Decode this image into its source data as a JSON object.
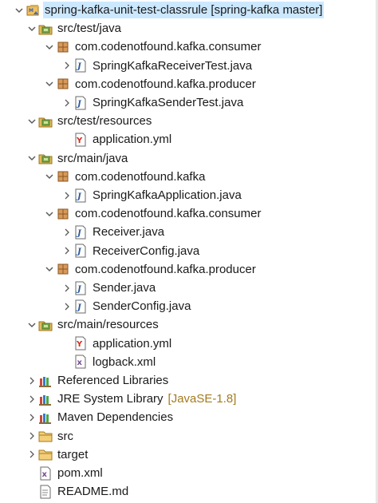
{
  "tree": {
    "nodes": [
      {
        "id": "project",
        "label": "spring-kafka-unit-test-classrule [spring-kafka master]",
        "icon": "maven-project-icon",
        "twisty": "expanded",
        "depth": 0,
        "selected": true
      },
      {
        "id": "src-test-java",
        "label": "src/test/java",
        "icon": "source-folder-icon",
        "twisty": "expanded",
        "depth": 1
      },
      {
        "id": "pkg-test-consumer",
        "label": "com.codenotfound.kafka.consumer",
        "icon": "package-icon",
        "twisty": "expanded",
        "depth": 2
      },
      {
        "id": "file-receiver-test",
        "label": "SpringKafkaReceiverTest.java",
        "icon": "java-file-icon",
        "twisty": "collapsed",
        "depth": 3
      },
      {
        "id": "pkg-test-producer",
        "label": "com.codenotfound.kafka.producer",
        "icon": "package-icon",
        "twisty": "expanded",
        "depth": 2
      },
      {
        "id": "file-sender-test",
        "label": "SpringKafkaSenderTest.java",
        "icon": "java-file-icon",
        "twisty": "collapsed",
        "depth": 3
      },
      {
        "id": "src-test-resources",
        "label": "src/test/resources",
        "icon": "source-folder-icon",
        "twisty": "expanded",
        "depth": 1
      },
      {
        "id": "file-test-app-yml",
        "label": "application.yml",
        "icon": "yaml-file-icon",
        "twisty": "none",
        "depth": 3
      },
      {
        "id": "src-main-java",
        "label": "src/main/java",
        "icon": "source-folder-icon",
        "twisty": "expanded",
        "depth": 1
      },
      {
        "id": "pkg-main",
        "label": "com.codenotfound.kafka",
        "icon": "package-icon",
        "twisty": "expanded",
        "depth": 2
      },
      {
        "id": "file-application",
        "label": "SpringKafkaApplication.java",
        "icon": "java-file-icon",
        "twisty": "collapsed",
        "depth": 3
      },
      {
        "id": "pkg-main-consumer",
        "label": "com.codenotfound.kafka.consumer",
        "icon": "package-icon",
        "twisty": "expanded",
        "depth": 2
      },
      {
        "id": "file-receiver",
        "label": "Receiver.java",
        "icon": "java-file-icon",
        "twisty": "collapsed",
        "depth": 3
      },
      {
        "id": "file-receiver-config",
        "label": "ReceiverConfig.java",
        "icon": "java-file-icon",
        "twisty": "collapsed",
        "depth": 3
      },
      {
        "id": "pkg-main-producer",
        "label": "com.codenotfound.kafka.producer",
        "icon": "package-icon",
        "twisty": "expanded",
        "depth": 2
      },
      {
        "id": "file-sender",
        "label": "Sender.java",
        "icon": "java-file-icon",
        "twisty": "collapsed",
        "depth": 3
      },
      {
        "id": "file-sender-config",
        "label": "SenderConfig.java",
        "icon": "java-file-icon",
        "twisty": "collapsed",
        "depth": 3
      },
      {
        "id": "src-main-resources",
        "label": "src/main/resources",
        "icon": "source-folder-icon",
        "twisty": "expanded",
        "depth": 1
      },
      {
        "id": "file-main-app-yml",
        "label": "application.yml",
        "icon": "yaml-file-icon",
        "twisty": "none",
        "depth": 3
      },
      {
        "id": "file-logback",
        "label": "logback.xml",
        "icon": "xml-file-icon",
        "twisty": "none",
        "depth": 3
      },
      {
        "id": "referenced-libraries",
        "label": "Referenced Libraries",
        "icon": "library-icon",
        "twisty": "collapsed",
        "depth": 1
      },
      {
        "id": "jre-library",
        "label": "JRE System Library",
        "decoration": "[JavaSE-1.8]",
        "icon": "library-icon",
        "twisty": "collapsed",
        "depth": 1
      },
      {
        "id": "maven-dependencies",
        "label": "Maven Dependencies",
        "icon": "library-icon",
        "twisty": "collapsed",
        "depth": 1
      },
      {
        "id": "folder-src",
        "label": "src",
        "icon": "folder-icon",
        "twisty": "collapsed",
        "depth": 1
      },
      {
        "id": "folder-target",
        "label": "target",
        "icon": "folder-icon",
        "twisty": "collapsed",
        "depth": 1
      },
      {
        "id": "file-pom",
        "label": "pom.xml",
        "icon": "xml-file-icon",
        "twisty": "none",
        "depth": 1
      },
      {
        "id": "file-readme",
        "label": "README.md",
        "icon": "text-file-icon",
        "twisty": "none",
        "depth": 1
      }
    ]
  },
  "colors": {
    "selection": "#cce8ff",
    "decoration": "#a47a1d",
    "twisty": "#5a5a5a"
  }
}
